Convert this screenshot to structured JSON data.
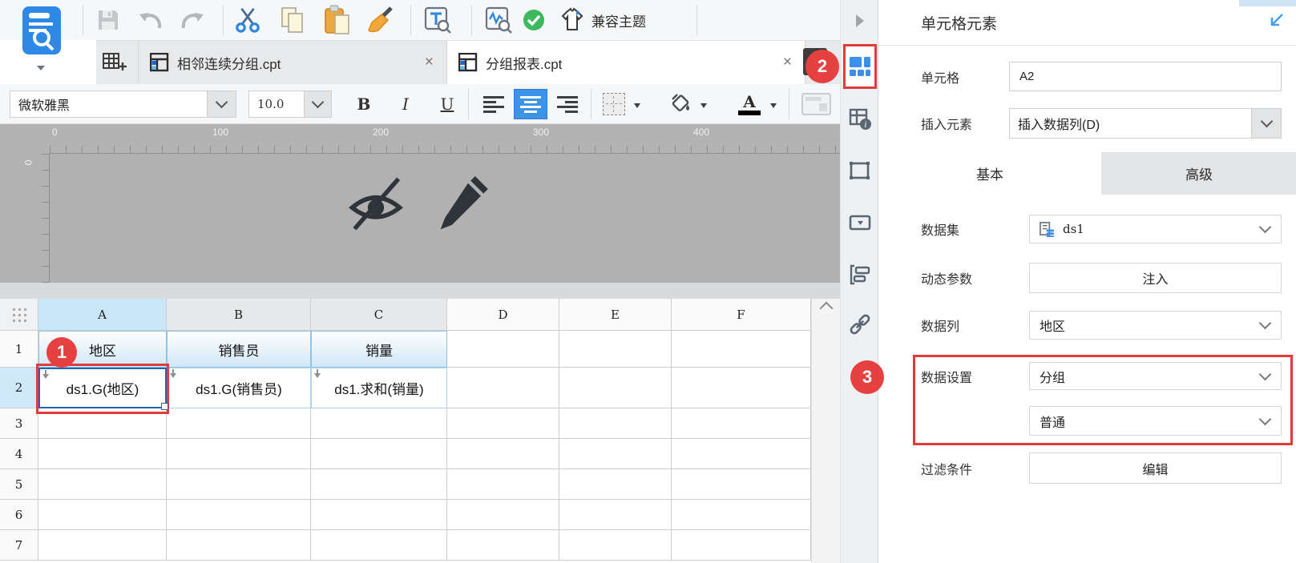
{
  "toolbar": {
    "compat_theme": "兼容主题",
    "icons": [
      "template-search",
      "save",
      "undo",
      "redo",
      "cut",
      "copy",
      "paste",
      "format-painter",
      "text-search",
      "template-preview",
      "validate-check",
      "theme-tshirt"
    ]
  },
  "tabs": [
    {
      "label": "相邻连续分组.cpt"
    },
    {
      "label": "分组报表.cpt"
    }
  ],
  "font_toolbar": {
    "font": "微软雅黑",
    "size": "10.0",
    "bold": "B",
    "italic": "I",
    "underline": "U"
  },
  "ruler": {
    "h_ticks": [
      "0",
      "100",
      "200",
      "300",
      "400"
    ],
    "v_tick": "0"
  },
  "sheet": {
    "col_headers": [
      "A",
      "B",
      "C",
      "D",
      "E",
      "F"
    ],
    "row_headers": [
      "1",
      "2",
      "3",
      "4",
      "5",
      "6",
      "7"
    ],
    "cells": {
      "A1": "地区",
      "B1": "销售员",
      "C1": "销量",
      "A2": "ds1.G(地区)",
      "B2": "ds1.G(销售员)",
      "C2": "ds1.求和(销量)"
    }
  },
  "annotations": {
    "step1": "1",
    "step2": "2",
    "step3": "3"
  },
  "sidebar": {
    "icons": [
      "collapse-right",
      "cell-element",
      "cell-attribute",
      "float-element",
      "widget",
      "condition-attribute",
      "hyperlink"
    ]
  },
  "panel": {
    "title": "单元格元素",
    "cell_label": "单元格",
    "cell_value": "A2",
    "insert_label": "插入元素",
    "insert_value": "插入数据列(D)",
    "tab_basic": "基本",
    "tab_advanced": "高级",
    "dataset_label": "数据集",
    "dataset_value": "ds1",
    "dynamic_param_label": "动态参数",
    "dynamic_param_button": "注入",
    "data_column_label": "数据列",
    "data_column_value": "地区",
    "data_setting_label": "数据设置",
    "data_setting_value1": "分组",
    "data_setting_value2": "普通",
    "filter_label": "过滤条件",
    "filter_button": "编辑"
  },
  "icons": {
    "close": "×"
  },
  "colors": {
    "annotation_red": "#e23b3b",
    "accent_blue": "#2f86df",
    "selection_blue": "#2166b4",
    "align_active_bg": "#3d93e8",
    "success_green": "#3cb95d",
    "paste_orange": "#e8a33d"
  }
}
